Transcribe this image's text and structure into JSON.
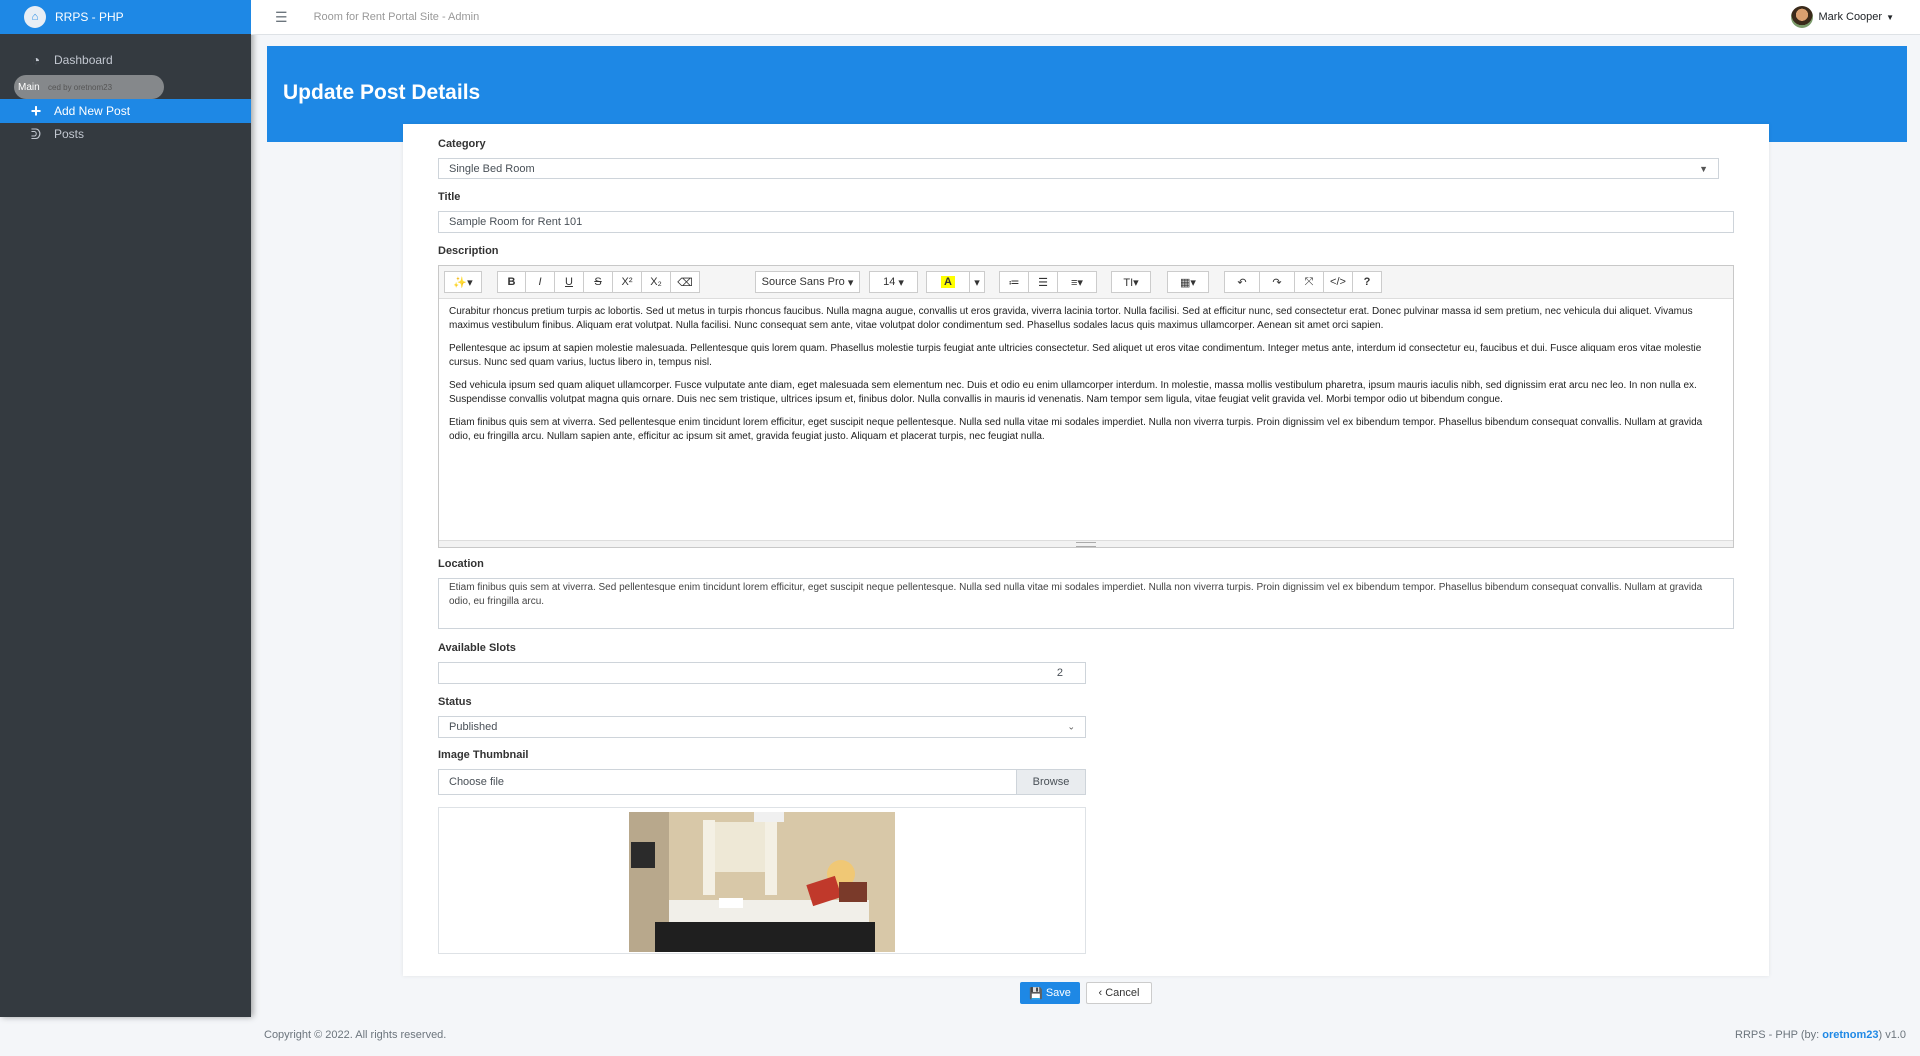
{
  "sidebar": {
    "brand": "RRPS - PHP",
    "header_main": "Main",
    "header_sub": "ced by oretnom23",
    "items": [
      {
        "label": "Dashboard",
        "icon": "tachometer-icon"
      },
      {
        "label": "Add New Post",
        "icon": "plus-icon"
      },
      {
        "label": "Posts",
        "icon": "blog-icon"
      }
    ]
  },
  "topbar": {
    "site_title": "Room for Rent Portal Site - Admin",
    "user_name": "Mark Cooper"
  },
  "page": {
    "title": "Update Post Details"
  },
  "form": {
    "category": {
      "label": "Category",
      "value": "Single Bed Room"
    },
    "title": {
      "label": "Title",
      "value": "Sample Room for Rent 101"
    },
    "description": {
      "label": "Description",
      "toolbar": {
        "font_name": "Source Sans Pro",
        "font_size": "14"
      },
      "paragraphs": [
        "Curabitur rhoncus pretium turpis ac lobortis. Sed ut metus in turpis rhoncus faucibus. Nulla magna augue, convallis ut eros gravida, viverra lacinia tortor. Nulla facilisi. Sed at efficitur nunc, sed consectetur erat. Donec pulvinar massa id sem pretium, nec vehicula dui aliquet. Vivamus maximus vestibulum finibus. Aliquam erat volutpat. Nulla facilisi. Nunc consequat sem ante, vitae volutpat dolor condimentum sed. Phasellus sodales lacus quis maximus ullamcorper. Aenean sit amet orci sapien.",
        "Pellentesque ac ipsum at sapien molestie malesuada. Pellentesque quis lorem quam. Phasellus molestie turpis feugiat ante ultricies consectetur. Sed aliquet ut eros vitae condimentum. Integer metus ante, interdum id consectetur eu, faucibus et dui. Fusce aliquam eros vitae molestie cursus. Nunc sed quam varius, luctus libero in, tempus nisl.",
        "Sed vehicula ipsum sed quam aliquet ullamcorper. Fusce vulputate ante diam, eget malesuada sem elementum nec. Duis et odio eu enim ullamcorper interdum. In molestie, massa mollis vestibulum pharetra, ipsum mauris iaculis nibh, sed dignissim erat arcu nec leo. In non nulla ex. Suspendisse convallis volutpat magna quis ornare. Duis nec sem tristique, ultrices ipsum et, finibus dolor. Nulla convallis in mauris id venenatis. Nam tempor sem ligula, vitae feugiat velit gravida vel. Morbi tempor odio ut bibendum congue.",
        "Etiam finibus quis sem at viverra. Sed pellentesque enim tincidunt lorem efficitur, eget suscipit neque pellentesque. Nulla sed nulla vitae mi sodales imperdiet. Nulla non viverra turpis. Proin dignissim vel ex bibendum tempor. Phasellus bibendum consequat convallis. Nullam at gravida odio, eu fringilla arcu. Nullam sapien ante, efficitur ac ipsum sit amet, gravida feugiat justo. Aliquam et placerat turpis, nec feugiat nulla."
      ]
    },
    "location": {
      "label": "Location",
      "value": "Etiam finibus quis sem at viverra. Sed pellentesque enim tincidunt lorem efficitur, eget suscipit neque pellentesque. Nulla sed nulla vitae mi sodales imperdiet. Nulla non viverra turpis. Proin dignissim vel ex bibendum tempor. Phasellus bibendum consequat convallis. Nullam at gravida odio, eu fringilla arcu."
    },
    "slots": {
      "label": "Available Slots",
      "value": "2"
    },
    "status": {
      "label": "Status",
      "value": "Published"
    },
    "thumbnail": {
      "label": "Image Thumbnail",
      "placeholder": "Choose file",
      "browse": "Browse"
    }
  },
  "buttons": {
    "save": "Save",
    "cancel": "Cancel"
  },
  "footer": {
    "copyright": "Copyright © 2022. All rights reserved.",
    "app": "RRPS - PHP (by:",
    "author": "oretnom23",
    "version": ") v1.0"
  },
  "colors": {
    "primary": "#1e88e5",
    "sidebar": "#343a40"
  }
}
